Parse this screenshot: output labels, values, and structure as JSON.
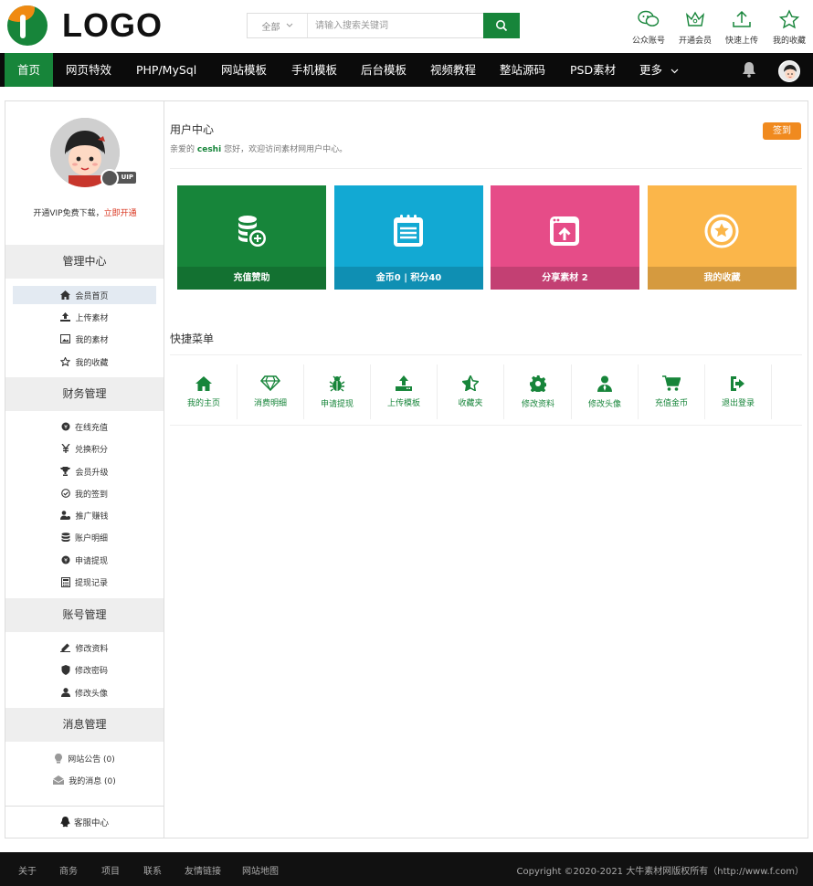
{
  "logo": {
    "text": "LOGO"
  },
  "search": {
    "category": "全部",
    "placeholder": "请输入搜索关键词"
  },
  "quick_links": [
    {
      "label": "公众账号",
      "icon": "wechat-icon"
    },
    {
      "label": "开通会员",
      "icon": "crown-icon"
    },
    {
      "label": "快速上传",
      "icon": "upload-icon"
    },
    {
      "label": "我的收藏",
      "icon": "star-icon"
    }
  ],
  "nav": {
    "items": [
      "首页",
      "网页特效",
      "PHP/MySql",
      "网站模板",
      "手机模板",
      "后台模板",
      "视频教程",
      "整站源码",
      "PSD素材",
      "更多"
    ],
    "active_index": 0
  },
  "sidebar": {
    "vip_note": "开通VIP免费下载，",
    "vip_link": "立即开通",
    "vip_badge": "UIP",
    "sections": [
      {
        "title": "管理中心",
        "items": [
          "会员首页",
          "上传素材",
          "我的素材",
          "我的收藏"
        ]
      },
      {
        "title": "财务管理",
        "items": [
          "在线充值",
          "兑换积分",
          "会员升级",
          "我的签到",
          "推广赚钱",
          "账户明细",
          "申请提现",
          "提现记录"
        ]
      },
      {
        "title": "账号管理",
        "items": [
          "修改资料",
          "修改密码",
          "修改头像"
        ]
      },
      {
        "title": "消息管理",
        "items": [
          "网站公告 (0)",
          "我的消息 (0)"
        ]
      }
    ],
    "footer": "客服中心"
  },
  "user_center": {
    "title": "用户中心",
    "welcome_prefix": "亲爱的",
    "username": "ceshi",
    "welcome_suffix": "您好，欢迎访问素材网用户中心。",
    "signin_label": "签到"
  },
  "cards": [
    {
      "label": "充值赞助",
      "color": "#17853a",
      "icon": "coins-icon"
    },
    {
      "label": "金币0 | 积分40",
      "color": "#12a9d3",
      "icon": "notepad-icon"
    },
    {
      "label": "分享素材 2",
      "color": "#e64c88",
      "icon": "share-icon"
    },
    {
      "label": "我的收藏",
      "color": "#fbb64a",
      "icon": "star-circle-icon"
    }
  ],
  "quick_menu": {
    "title": "快捷菜单",
    "items": [
      {
        "label": "我的主页",
        "icon": "home-icon"
      },
      {
        "label": "消费明细",
        "icon": "diamond-icon"
      },
      {
        "label": "申请提现",
        "icon": "bug-icon"
      },
      {
        "label": "上传模板",
        "icon": "upload-icon"
      },
      {
        "label": "收藏夹",
        "icon": "star-icon"
      },
      {
        "label": "修改资料",
        "icon": "gear-icon"
      },
      {
        "label": "修改头像",
        "icon": "user-icon"
      },
      {
        "label": "充值金币",
        "icon": "cart-icon"
      },
      {
        "label": "退出登录",
        "icon": "logout-icon"
      }
    ]
  },
  "footer": {
    "links": [
      "关于",
      "商务",
      "项目",
      "联系",
      "友情链接",
      "网站地图"
    ],
    "copyright": "Copyright ©2020-2021 大牛素材网版权所有（http://www.f.com）"
  }
}
